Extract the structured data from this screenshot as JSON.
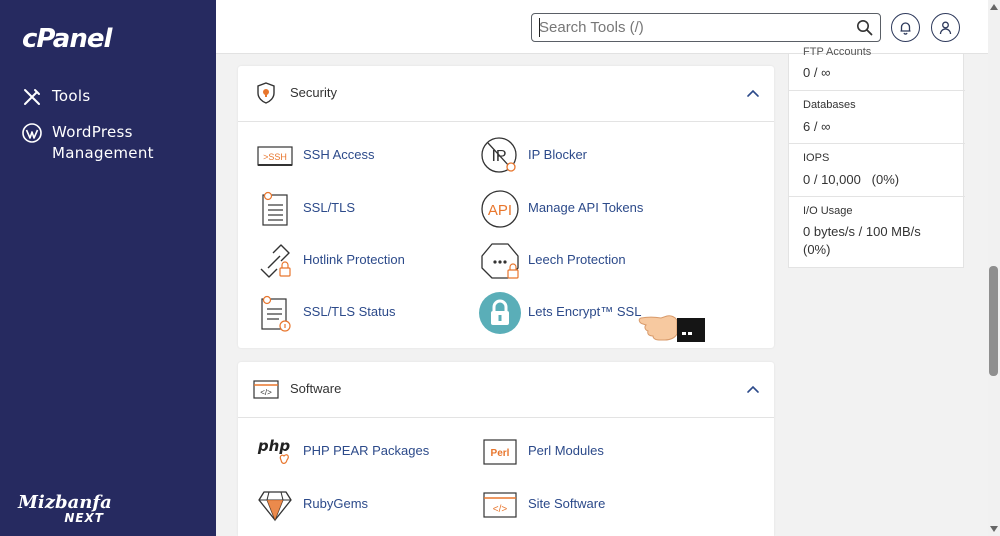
{
  "sidebar": {
    "logo": "cPanel",
    "items": [
      {
        "label": "Tools"
      },
      {
        "label": "WordPress\nManagement"
      }
    ],
    "brand_top": "Mizbanfa",
    "brand_bottom": "NEXT"
  },
  "topbar": {
    "search_placeholder": "Search Tools (/)"
  },
  "security": {
    "title": "Security",
    "tools": [
      {
        "label": "SSH Access"
      },
      {
        "label": "IP Blocker"
      },
      {
        "label": "SSL/TLS"
      },
      {
        "label": "Manage API Tokens"
      },
      {
        "label": "Hotlink Protection"
      },
      {
        "label": "Leech Protection"
      },
      {
        "label": "SSL/TLS Status"
      },
      {
        "label": "Lets Encrypt™ SSL"
      }
    ]
  },
  "software": {
    "title": "Software",
    "tools": [
      {
        "label": "PHP PEAR Packages"
      },
      {
        "label": "Perl Modules"
      },
      {
        "label": "RubyGems"
      },
      {
        "label": "Site Software"
      }
    ]
  },
  "icon_text": {
    "ssh": ">SSH",
    "api": "API",
    "ip": "IP",
    "php": "php",
    "perl": "Perl",
    "code": "</>"
  },
  "stats": {
    "partial_label": "FTP Accounts",
    "ftp_value": "0 / ∞",
    "databases_label": "Databases",
    "databases_value": "6 / ∞",
    "iops_label": "IOPS",
    "iops_value": "0 / 10,000   (0%)",
    "io_label": "I/O Usage",
    "io_value": "0 bytes/s / 100 MB/s\n  (0%)"
  },
  "colors": {
    "sidebar_bg": "#262a60",
    "link": "#2c4a8a",
    "accent_orange": "#e8762d"
  }
}
